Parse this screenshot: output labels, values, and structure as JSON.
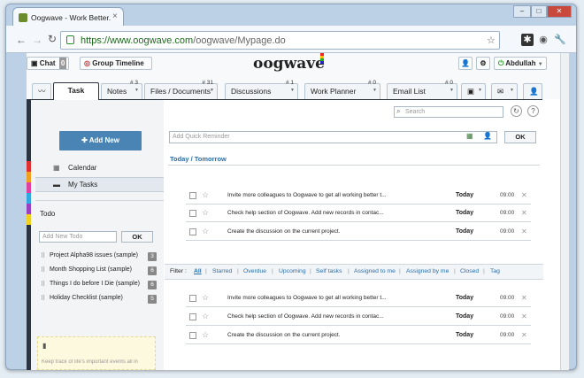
{
  "browser": {
    "tab_title": "Oogwave - Work Better. To",
    "tab_close": "×",
    "url_scheme": "https://",
    "url_host": "www.oogwave.com",
    "url_path": "/oogwave/Mypage.do",
    "win_min": "–",
    "win_max": "□",
    "win_close": "✕"
  },
  "header": {
    "chat_label": "Chat",
    "chat_count": "0",
    "group_timeline_label": "Group Timeline",
    "logo": "oogwave",
    "user_name": "Abdullah"
  },
  "tabs": [
    {
      "label": "Task",
      "count": ""
    },
    {
      "label": "Notes",
      "count": "# 3"
    },
    {
      "label": "Files / Documents",
      "count": "# 31"
    },
    {
      "label": "Discussions",
      "count": "# 1"
    },
    {
      "label": "Work Planner",
      "count": "# 0"
    },
    {
      "label": "Email List",
      "count": "# 0"
    }
  ],
  "search": {
    "placeholder": "Search"
  },
  "sidebar": {
    "add_new": "Add New",
    "calendar": "Calendar",
    "my_tasks": "My Tasks",
    "todo_heading": "Todo",
    "todo_placeholder": "Add New Todo",
    "ok": "OK",
    "todos": [
      {
        "label": "Project Alpha98 issues (sample)",
        "count": "3"
      },
      {
        "label": "Month Shopping List (sample)",
        "count": "6"
      },
      {
        "label": "Things I do before I Die (sample)",
        "count": "6"
      },
      {
        "label": "Holiday Checklist (sample)",
        "count": "5"
      }
    ],
    "tip_text": "Keep track of life's important events all in"
  },
  "main": {
    "quick_reminder_placeholder": "Add Quick Reminder",
    "ok": "OK",
    "section_title": "Today / Tomorrow",
    "tasks_top": [
      {
        "text": "Invite more colleagues to Oogwave to get all working better t...",
        "day": "Today",
        "time": "09:00"
      },
      {
        "text": "Check help section of Oogwave. Add new records in contac...",
        "day": "Today",
        "time": "09:00"
      },
      {
        "text": "Create the discussion on the current project.",
        "day": "Today",
        "time": "09:00"
      }
    ],
    "filter_label": "Filter :",
    "filters": [
      "All",
      "Starred",
      "Overdue",
      "Upcoming",
      "Self tasks",
      "Assigned to me",
      "Assigned by me",
      "Closed",
      "Tag"
    ],
    "tasks_bottom": [
      {
        "text": "Invite more colleagues to Oogwave to get all working better t...",
        "day": "Today",
        "time": "09:00"
      },
      {
        "text": "Check help section of Oogwave. Add new records in contac...",
        "day": "Today",
        "time": "09:00"
      },
      {
        "text": "Create the discussion on the current project.",
        "day": "Today",
        "time": "09:00"
      }
    ]
  },
  "colors": {
    "accent": "#4a84b4",
    "link": "#2a6da8",
    "dark_frame": "#2c3440"
  }
}
